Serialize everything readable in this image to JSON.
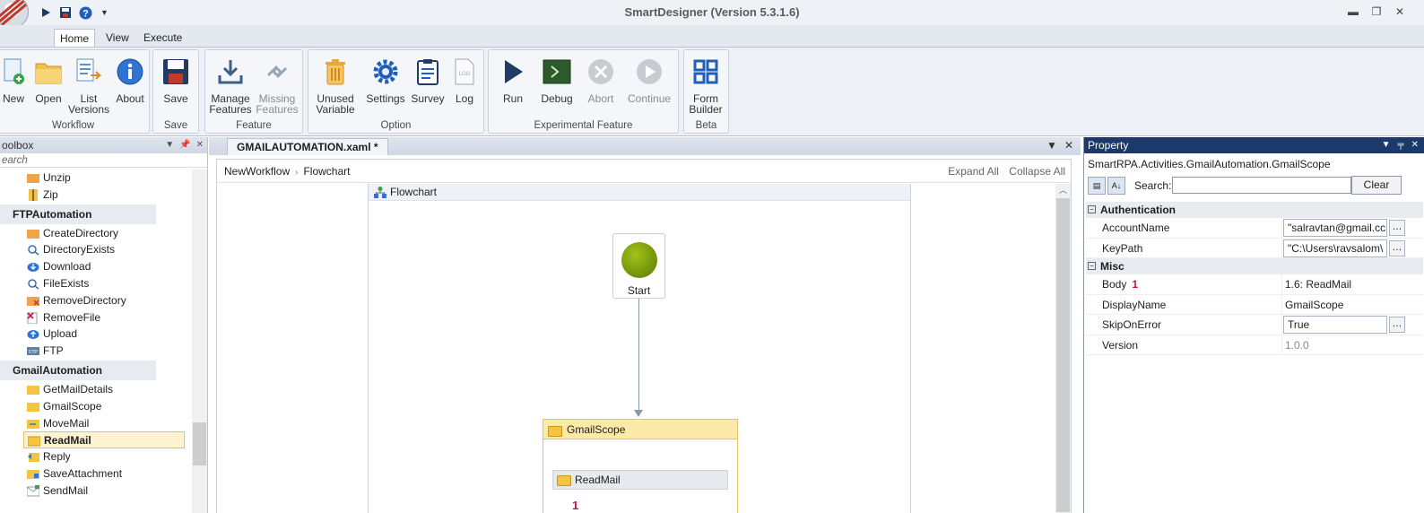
{
  "window": {
    "title": "SmartDesigner (Version 5.3.1.6)"
  },
  "menu_tabs": [
    "Home",
    "View",
    "Execute"
  ],
  "ribbon": {
    "groups": [
      {
        "label": "Workflow",
        "buttons": [
          "New",
          "Open",
          "List Versions",
          "About"
        ]
      },
      {
        "label": "Save",
        "buttons": [
          "Save"
        ]
      },
      {
        "label": "Feature",
        "buttons": [
          "Manage Features",
          "Missing Features"
        ]
      },
      {
        "label": "Option",
        "buttons": [
          "Unused Variable",
          "Settings",
          "Survey",
          "Log"
        ]
      },
      {
        "label": "Experimental Feature",
        "buttons": [
          "Run",
          "Debug",
          "Abort",
          "Continue"
        ]
      },
      {
        "label": "Beta",
        "buttons": [
          "Form Builder"
        ]
      }
    ],
    "lbl": {
      "list_1": "List",
      "list_2": "Versions",
      "manage_1": "Manage",
      "manage_2": "Features",
      "missing_1": "Missing",
      "missing_2": "Features",
      "unused_1": "Unused",
      "unused_2": "Variable",
      "form_1": "Form",
      "form_2": "Builder"
    }
  },
  "toolbox": {
    "title": "oolbox",
    "search_placeholder": "earch",
    "items_top": [
      "Unzip",
      "Zip"
    ],
    "categories": [
      {
        "name": "FTPAutomation",
        "items": [
          "CreateDirectory",
          "DirectoryExists",
          "Download",
          "FileExists",
          "RemoveDirectory",
          "RemoveFile",
          "Upload",
          "FTP"
        ]
      },
      {
        "name": "GmailAutomation",
        "items": [
          "GetMailDetails",
          "GmailScope",
          "MoveMail",
          "ReadMail",
          "Reply",
          "SaveAttachment",
          "SendMail"
        ]
      }
    ],
    "selected_item": "ReadMail"
  },
  "document": {
    "tab_title": "GMAILAUTOMATION.xaml *",
    "breadcrumb": [
      "NewWorkflow",
      "Flowchart"
    ],
    "expand_all": "Expand All",
    "collapse_all": "Collapse All",
    "flowchart_title": "Flowchart",
    "start_label": "Start",
    "scope_title": "GmailScope",
    "inner_activity": "ReadMail",
    "error_badge": "1"
  },
  "property": {
    "title": "Property",
    "type_name": "SmartRPA.Activities.GmailAutomation.GmailScope",
    "search_label": "Search:",
    "clear_label": "Clear",
    "categories": [
      {
        "name": "Authentication",
        "rows": [
          {
            "name": "AccountName",
            "value": "\"salravtan@gmail.cc"
          },
          {
            "name": "KeyPath",
            "value": "\"C:\\Users\\ravsalom\\"
          }
        ]
      },
      {
        "name": "Misc",
        "rows": [
          {
            "name": "Body",
            "badge": "1",
            "value": "1.6: ReadMail"
          },
          {
            "name": "DisplayName",
            "value": "GmailScope"
          },
          {
            "name": "SkipOnError",
            "value": "True"
          },
          {
            "name": "Version",
            "value": "1.0.0"
          }
        ]
      }
    ]
  },
  "colors": {
    "accent_navy": "#1b3a6b",
    "error_red": "#d0103a",
    "scope_header": "#fde9a8",
    "start_green": "#7fa010"
  }
}
